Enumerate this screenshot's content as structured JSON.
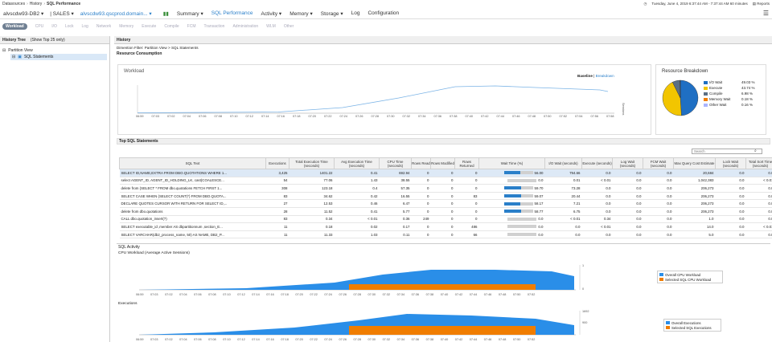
{
  "breadcrumb": [
    "Datasources",
    "History",
    "SQL Performance"
  ],
  "topright": {
    "datetime": "Tuesday, June 4, 2019 6:37:44 AM - 7:37:44 AM 60 minutes",
    "reports": "Reports"
  },
  "nav": {
    "host": "alvscdw93-DB2",
    "db": "SALES",
    "target": "alvscdw93.qscprod.domain...",
    "menus": [
      "Summary",
      "SQL Performance",
      "Activity",
      "Memory",
      "Storage",
      "Log",
      "Configuration"
    ],
    "active_menu": "SQL Performance"
  },
  "subnav": {
    "items": [
      "Workload",
      "CPU",
      "I/O",
      "Lock",
      "Log",
      "Network",
      "Memory",
      "Execute",
      "Compile",
      "FCM",
      "Transaction",
      "Administration",
      "WLM",
      "Other"
    ],
    "active": "Workload"
  },
  "left": {
    "title": "History Tree",
    "subtitle": "(Show Top 25 only)",
    "nodes": [
      "Partition View",
      "SQL Statements"
    ]
  },
  "main": {
    "title": "History",
    "filter": "Dimention Filter: Partition View > SQL Statements",
    "rc_title": "Resource Consumption",
    "workload_title": "Workload",
    "baseline_label": "Baseline",
    "breakdown_label": "Breakdown",
    "rb_title": "Resource Breakdown",
    "top_sql_title": "Top SQL Statements",
    "search_placeholder": "Search",
    "sql_activity_title": "SQL Activity",
    "cpu_title": "CPU Workload (Average Active Sessions)",
    "exec_title": "Executions"
  },
  "colors": {
    "accent": "#2a7fc9",
    "io": "#1f6fc3",
    "execute": "#f2c500",
    "compile": "#5a6f84",
    "memory": "#f07d00",
    "other": "#a9b4ff",
    "orange": "#f07d00",
    "blue": "#2a8ee8"
  },
  "resource_breakdown": [
    {
      "name": "I/O Wait",
      "pct": "49.03 %",
      "value": 49.03,
      "color": "#1f6fc3"
    },
    {
      "name": "Execute",
      "pct": "43.74 %",
      "value": 43.74,
      "color": "#f2c500"
    },
    {
      "name": "Compile",
      "pct": "6.98 %",
      "value": 6.98,
      "color": "#5a6f84"
    },
    {
      "name": "Memory Wait",
      "pct": "0.18 %",
      "value": 0.18,
      "color": "#f07d00"
    },
    {
      "name": "Other Wait",
      "pct": "0.16 %",
      "value": 0.16,
      "color": "#a9b4ff"
    }
  ],
  "table": {
    "headers": [
      "SQL Text",
      "Executions",
      "Total Execution Time (seconds)",
      "Avg Execution Time (seconds)",
      "CPU Time (seconds)",
      "Rows Read",
      "Rows Modified",
      "Rows Returned",
      "Wait Time (%)",
      "I/O Wait (seconds)",
      "Execute (seconds)",
      "Log Wait (seconds)",
      "FCM Wait (seconds)",
      "Max Query Cost Estimate",
      "Lock Wait (seconds)",
      "Total Sort Time (seconds)"
    ],
    "rows": [
      {
        "sql": "SELECT ID,NAME,EXTRA FROM DBO.QUOTATIONS WHERE 1...",
        "exec": "3,425",
        "tot": "1401.22",
        "avg": "0.41",
        "cpu": "692.94",
        "rr": "0",
        "rm": "0",
        "rret": "0",
        "wait": "56.00",
        "waitv": 0.56,
        "io": "794.66",
        "ex": "0.0",
        "log": "0.0",
        "fcm": "0.0",
        "cost": "20,684",
        "lock": "0.0",
        "sort": "0.0"
      },
      {
        "sql": "select AGENT_ID, AGENT_ID_HOLDING_LK, cast(COALESCE...",
        "exec": "54",
        "tot": "77.06",
        "avg": "1.43",
        "cpu": "38.55",
        "rr": "0",
        "rm": "0",
        "rret": "0",
        "wait": "0.0",
        "waitv": 0.0,
        "io": "0.01",
        "ex": "< 0.01",
        "log": "0.0",
        "fcm": "0.0",
        "cost": "1,042,383",
        "lock": "0.0",
        "sort": "< 0.01"
      },
      {
        "sql": "delete from (SELECT * FROM dbo.quotations FETCH FIRST 1...",
        "exec": "308",
        "tot": "123.18",
        "avg": "0.4",
        "cpu": "57.35",
        "rr": "0",
        "rm": "0",
        "rret": "0",
        "wait": "59.70",
        "waitv": 0.597,
        "io": "73.28",
        "ex": "0.0",
        "log": "0.0",
        "fcm": "0.0",
        "cost": "206,273",
        "lock": "0.0",
        "sort": "0.0"
      },
      {
        "sql": "SELECT CASE WHEN (SELECT COUNT(*) FROM DBO.QUOTA...",
        "exec": "83",
        "tot": "34.62",
        "avg": "0.42",
        "cpu": "16.55",
        "rr": "0",
        "rm": "0",
        "rret": "83",
        "wait": "59.07",
        "waitv": 0.5907,
        "io": "20.44",
        "ex": "0.0",
        "log": "0.0",
        "fcm": "0.0",
        "cost": "206,273",
        "lock": "0.0",
        "sort": "0.0"
      },
      {
        "sql": "DECLARE QUOTES CURSOR WITH RETURN FOR SELECT ID,...",
        "exec": "27",
        "tot": "12.53",
        "avg": "0.46",
        "cpu": "6.47",
        "rr": "0",
        "rm": "0",
        "rret": "0",
        "wait": "58.17",
        "waitv": 0.5817,
        "io": "7.21",
        "ex": "0.0",
        "log": "0.0",
        "fcm": "0.0",
        "cost": "206,273",
        "lock": "0.0",
        "sort": "0.0"
      },
      {
        "sql": "delete from dbo.quotations",
        "exec": "28",
        "tot": "11.52",
        "avg": "0.41",
        "cpu": "5.77",
        "rr": "0",
        "rm": "0",
        "rret": "0",
        "wait": "58.77",
        "waitv": 0.5877,
        "io": "6.75",
        "ex": "0.0",
        "log": "0.0",
        "fcm": "0.0",
        "cost": "206,273",
        "lock": "0.0",
        "sort": "0.0"
      },
      {
        "sql": "CALL dbo.quotation_insert(?)",
        "exec": "83",
        "tot": "0.34",
        "avg": "< 0.01",
        "cpu": "0.36",
        "rr": "249",
        "rm": "0",
        "rret": "0",
        "wait": "0.0",
        "waitv": 0.0,
        "io": "< 0.01",
        "ex": "0.34",
        "log": "0.0",
        "fcm": "0.0",
        "cost": "1.0",
        "lock": "0.0",
        "sort": "0.0"
      },
      {
        "sql": "SELECT executable_id ,member AS dbpartitionnum ,section_E...",
        "exec": "11",
        "tot": "0.18",
        "avg": "0.02",
        "cpu": "0.17",
        "rr": "0",
        "rm": "0",
        "rret": "486",
        "wait": "0.0",
        "waitv": 0.0,
        "io": "0.0",
        "ex": "< 0.01",
        "log": "0.0",
        "fcm": "0.0",
        "cost": "14.0",
        "lock": "0.0",
        "sort": "< 0.01"
      },
      {
        "sql": "SELECT VARCHAR(db2_process_name, 50) AS NAME, DB2_P...",
        "exec": "11",
        "tot": "11.33",
        "avg": "1.03",
        "cpu": "0.11",
        "rr": "0",
        "rm": "0",
        "rret": "66",
        "wait": "0.0",
        "waitv": 0.0,
        "io": "0.0",
        "ex": "0.0",
        "log": "0.0",
        "fcm": "0.0",
        "cost": "5.0",
        "lock": "0.0",
        "sort": "0.0"
      }
    ]
  },
  "time_ticks": [
    "06:59",
    "07:03",
    "07:02",
    "07:04",
    "07:06",
    "07:08",
    "07:10",
    "07:12",
    "07:14",
    "07:16",
    "07:18",
    "07:20",
    "07:22",
    "07:24",
    "07:26",
    "07:28",
    "07:30",
    "07:32",
    "07:34",
    "07:36",
    "07:38",
    "07:40",
    "07:42",
    "07:44",
    "07:46",
    "07:48",
    "07:50",
    "07:52",
    "07:54",
    "07:56",
    "07:58"
  ],
  "workload_yaxis": "Sessions",
  "cpu_legend": [
    "Overall CPU Workload",
    "Selected SQL CPU Workload"
  ],
  "exec_legend": [
    "Overall Executions",
    "Selected SQL Executions"
  ],
  "exec_y": [
    "1692",
    "900"
  ],
  "cpu_y": [
    "1",
    "0"
  ]
}
